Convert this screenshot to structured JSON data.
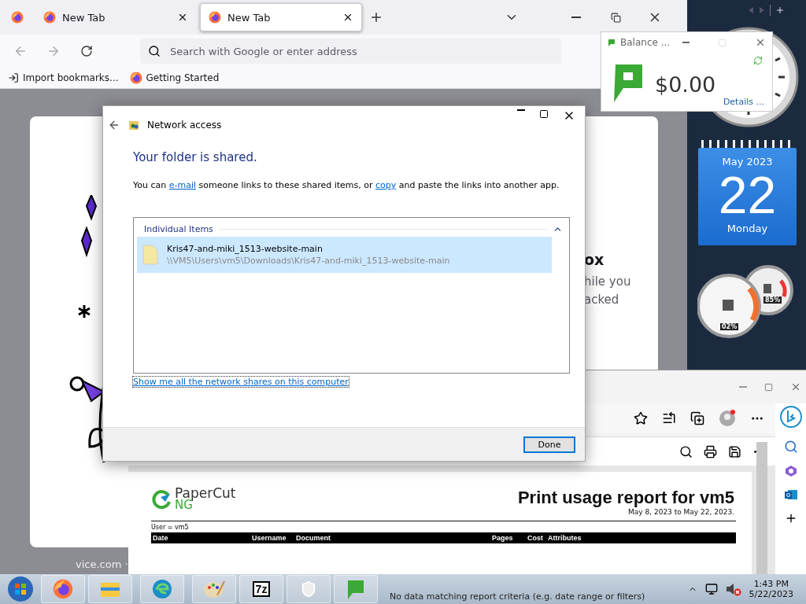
{
  "firefox": {
    "tabs": [
      {
        "label": "New Tab",
        "selected": false
      },
      {
        "label": "New Tab",
        "selected": true
      }
    ],
    "address_bar": {
      "placeholder": "Search with Google or enter address"
    },
    "bookmarks": [
      "Import bookmarks...",
      "Getting Started"
    ],
    "page_fragments": [
      "ox",
      "hile you",
      "acked"
    ],
    "footer_fragment": "vice.com ·"
  },
  "balance_gadget": {
    "title": "Balance ...",
    "amount": "$0.00",
    "details_link": "Details ..."
  },
  "calendar_gadget": {
    "month": "May 2023",
    "day": "22",
    "weekday": "Monday"
  },
  "meter_gadget": {
    "cpu": "02%",
    "memory": "85%"
  },
  "dialog": {
    "title": "Network access",
    "heading": "Your folder is shared.",
    "message": [
      {
        "kind": "text",
        "text": "You can"
      },
      {
        "kind": "link",
        "text": "e-mail"
      },
      {
        "kind": "text",
        "text": "someone links to these shared items, or"
      },
      {
        "kind": "link",
        "text": "copy"
      },
      {
        "kind": "text",
        "text": "and paste the links into another app."
      }
    ],
    "group": {
      "label": "Individual Items",
      "expanded": true,
      "items": [
        {
          "name": "Kris47-and-miki_1513-website-main",
          "path": "\\\\VM5\\Users\\vm5\\Downloads\\Kris47-and-miki_1513-website-main",
          "selected": true
        }
      ]
    },
    "shares_link": "Show me all the network shares on this computer",
    "done_button": "Done"
  },
  "edge": {
    "report": {
      "logo_name": "PaperCut",
      "logo_sub": "NG",
      "title": "Print usage report for vm5",
      "date_range": "May 8, 2023 to May 22, 2023.",
      "filter": "User = vm5",
      "columns": [
        "Date",
        "Username",
        "Document",
        "Pages",
        "Cost",
        "Attributes"
      ],
      "empty_message": "No data matching report criteria (e.g. date range or filters)"
    }
  },
  "taskbar": {
    "seven_zip_label": "7z",
    "volume_muted": true,
    "time": "1:43 PM",
    "date": "5/22/2023"
  }
}
